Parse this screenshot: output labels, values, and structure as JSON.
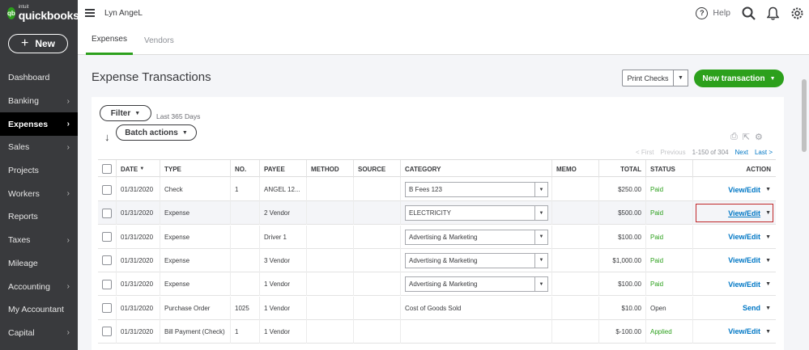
{
  "brand": {
    "intuit": "intuit",
    "name": "quickbooks",
    "accent": "#2ca01c"
  },
  "new_button": {
    "label": "New"
  },
  "sidebar": {
    "items": [
      {
        "label": "Dashboard",
        "chevron": false,
        "active": false
      },
      {
        "label": "Banking",
        "chevron": true,
        "active": false
      },
      {
        "label": "Expenses",
        "chevron": true,
        "active": true
      },
      {
        "label": "Sales",
        "chevron": true,
        "active": false
      },
      {
        "label": "Projects",
        "chevron": false,
        "active": false
      },
      {
        "label": "Workers",
        "chevron": true,
        "active": false
      },
      {
        "label": "Reports",
        "chevron": false,
        "active": false
      },
      {
        "label": "Taxes",
        "chevron": true,
        "active": false
      },
      {
        "label": "Mileage",
        "chevron": false,
        "active": false
      },
      {
        "label": "Accounting",
        "chevron": true,
        "active": false
      },
      {
        "label": "My Accountant",
        "chevron": false,
        "active": false
      },
      {
        "label": "Capital",
        "chevron": true,
        "active": false
      }
    ]
  },
  "topbar": {
    "company": "Lyn AngeL",
    "help_label": "Help"
  },
  "tabs": [
    {
      "label": "Expenses"
    },
    {
      "label": "Vendors"
    }
  ],
  "page": {
    "title": "Expense Transactions"
  },
  "actions": {
    "print_checks": "Print Checks",
    "new_transaction": "New transaction"
  },
  "filter": {
    "label": "Filter",
    "note": "Last 365 Days"
  },
  "batch": {
    "label": "Batch actions"
  },
  "pager": {
    "first": "< First",
    "previous": "Previous",
    "range": "1-150 of 304",
    "next": "Next",
    "last": "Last >"
  },
  "table": {
    "headers": {
      "date": "DATE",
      "type": "TYPE",
      "no": "NO.",
      "payee": "PAYEE",
      "method": "METHOD",
      "source": "SOURCE",
      "category": "CATEGORY",
      "memo": "MEMO",
      "total": "TOTAL",
      "status": "STATUS",
      "action": "ACTION"
    },
    "rows": [
      {
        "date": "01/31/2020",
        "type": "Check",
        "no": "1",
        "payee": "ANGEL 12...",
        "category": "B Fees 123",
        "category_select": true,
        "total": "$250.00",
        "status": "Paid",
        "action": "View/Edit"
      },
      {
        "date": "01/31/2020",
        "type": "Expense",
        "no": "",
        "payee": "2 Vendor",
        "category": "ELECTRICITY",
        "category_select": true,
        "total": "$500.00",
        "status": "Paid",
        "action": "View/Edit"
      },
      {
        "date": "01/31/2020",
        "type": "Expense",
        "no": "",
        "payee": "Driver 1",
        "category": "Advertising & Marketing",
        "category_select": true,
        "total": "$100.00",
        "status": "Paid",
        "action": "View/Edit"
      },
      {
        "date": "01/31/2020",
        "type": "Expense",
        "no": "",
        "payee": "3 Vendor",
        "category": "Advertising & Marketing",
        "category_select": true,
        "total": "$1,000.00",
        "status": "Paid",
        "action": "View/Edit"
      },
      {
        "date": "01/31/2020",
        "type": "Expense",
        "no": "",
        "payee": "1 Vendor",
        "category": "Advertising & Marketing",
        "category_select": true,
        "total": "$100.00",
        "status": "Paid",
        "action": "View/Edit"
      },
      {
        "date": "01/31/2020",
        "type": "Purchase Order",
        "no": "1025",
        "payee": "1 Vendor",
        "category": "Cost of Goods Sold",
        "category_select": false,
        "total": "$10.00",
        "status": "Open",
        "action": "Send"
      },
      {
        "date": "01/31/2020",
        "type": "Bill Payment (Check)",
        "no": "1",
        "payee": "1 Vendor",
        "category": "",
        "category_select": false,
        "total": "$-100.00",
        "status": "Applied",
        "action": "View/Edit"
      }
    ]
  }
}
